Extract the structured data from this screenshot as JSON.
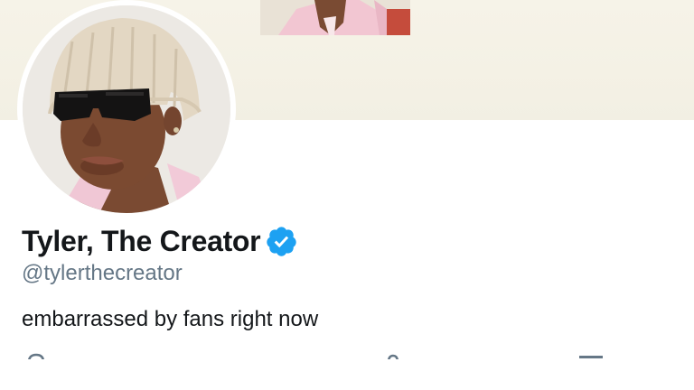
{
  "profile": {
    "display_name": "Tyler, The Creator",
    "handle": "@tylerthecreator",
    "bio": "embarrassed by fans right now",
    "verified": true
  },
  "icons": {
    "verified": "verified-badge-icon",
    "location": "location-pin-icon",
    "link": "link-icon",
    "calendar": "calendar-icon"
  },
  "colors": {
    "verified_blue": "#1da1f2",
    "name_text": "#14171a",
    "handle_text": "#657786",
    "banner_bg": "#f5f2e6"
  }
}
